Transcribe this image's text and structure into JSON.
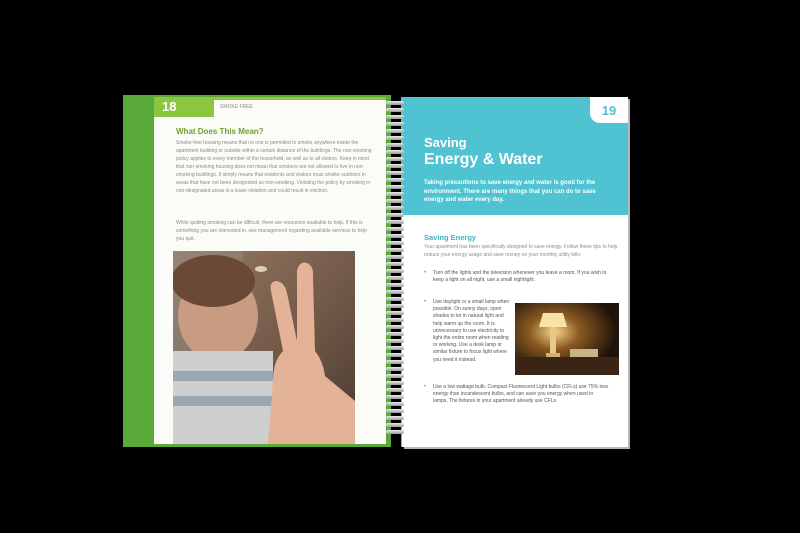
{
  "left_page": {
    "page_number": "18",
    "running_head": "SMOKE FREE",
    "heading": "What Does This Mean?",
    "paragraph1": "Smoke-free housing means that no one is permitted to smoke anywhere inside the apartment building or outside within a certain distance of the buildings. The non-smoking policy applies to every member of the household, as well as to all visitors. Keep in mind that non-smoking housing does not mean that smokers are not allowed to live in non-smoking buildings. It simply means that residents and visitors must smoke outdoors in areas that have not been designated as non-smoking. Violating the policy by smoking in non-designated areas is a lease violation and could result in eviction.",
    "paragraph2": "While quitting smoking can be difficult, there are resources available to help. If this is something you are interested in, see management regarding available services to help you quit."
  },
  "right_page": {
    "page_number": "19",
    "title_line1": "Saving",
    "title_line2": "Energy & Water",
    "intro": "Taking precautions to save energy and water is good for the environment. There are many things that you can do to save energy and water every day.",
    "section_heading": "Saving Energy",
    "section_intro": "Your apartment has been specifically designed to save energy. Follow these tips to help reduce your energy usage and save money on your monthly utility bills:",
    "bullets": [
      "Turn off the lights and the television whenever you leave a room. If you wish to keep a light on all night, use a small nightlight.",
      "Use daylight or a small lamp when possible. On sunny days, open shades to let in natural light and help warm up the room. It is unnecessary to use electricity to light the entire room when reading or working. Use a desk lamp or similar fixture to focus light where you need it instead.",
      "Use a low wattage bulb. Compact Fluorescent Light bulbs (CFLs) use 75% less energy than incandescent bulbs, and can save you energy when used in lamps. The fixtures in your apartment already use CFLs."
    ]
  },
  "colors": {
    "green": "#8cc63f",
    "teal": "#4fc3d1",
    "background": "#000000"
  }
}
